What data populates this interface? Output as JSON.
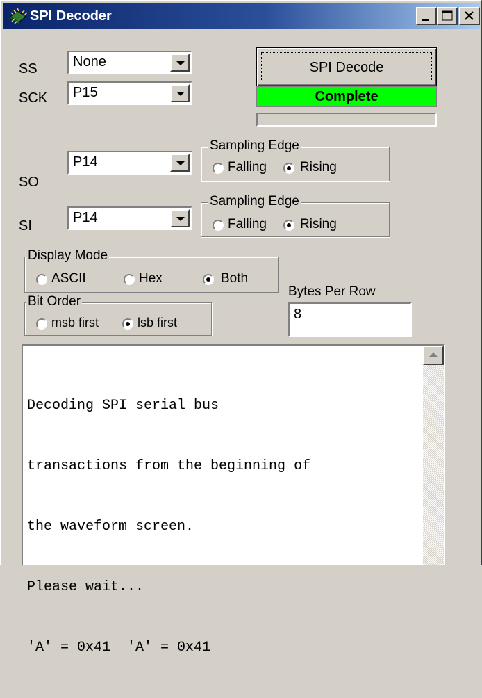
{
  "window": {
    "title": "SPI Decoder"
  },
  "labels": {
    "ss": "SS",
    "sck": "SCK",
    "so": "SO",
    "si": "SI"
  },
  "combos": {
    "ss": "None",
    "sck": "P15",
    "so": "P14",
    "si": "P14"
  },
  "decode": {
    "button_label": "SPI Decode",
    "status": "Complete",
    "status_color": "#00ff00"
  },
  "so_edge": {
    "legend": "Sampling Edge",
    "options": [
      "Falling",
      "Rising"
    ],
    "selected": "Rising"
  },
  "si_edge": {
    "legend": "Sampling Edge",
    "options": [
      "Falling",
      "Rising"
    ],
    "selected": "Rising"
  },
  "display_mode": {
    "legend": "Display Mode",
    "options": [
      "ASCII",
      "Hex",
      "Both"
    ],
    "selected": "Both"
  },
  "bit_order": {
    "legend": "Bit Order",
    "options": [
      "msb first",
      "lsb first"
    ],
    "selected": "lsb first"
  },
  "bytes_per_row": {
    "label": "Bytes Per Row",
    "value": "8"
  },
  "output": {
    "lines": [
      "Decoding SPI serial bus",
      "transactions from the beginning of",
      "the waveform screen.",
      "Please wait...",
      "'A' = 0x41  'A' = 0x41"
    ]
  },
  "titlebar_buttons": {
    "minimize_icon": "minimize-icon",
    "maximize_icon": "maximize-icon",
    "close_icon": "close-icon"
  }
}
